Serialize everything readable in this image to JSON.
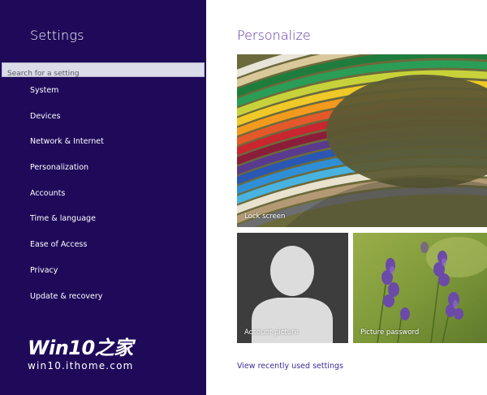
{
  "sidebar": {
    "title": "Settings",
    "search_placeholder": "Search for a setting",
    "items": [
      {
        "label": "System"
      },
      {
        "label": "Devices"
      },
      {
        "label": "Network & Internet"
      },
      {
        "label": "Personalization"
      },
      {
        "label": "Accounts"
      },
      {
        "label": "Time & language"
      },
      {
        "label": "Ease of Access"
      },
      {
        "label": "Privacy"
      },
      {
        "label": "Update & recovery"
      }
    ],
    "watermark_logo": "Win10之家",
    "watermark_url": "win10.ithome.com"
  },
  "main": {
    "title": "Personalize",
    "tiles": {
      "lock_screen": "Lock screen",
      "account_picture": "Account picture",
      "picture_password": "Picture password"
    },
    "recent_link": "View recently used settings"
  },
  "colors": {
    "sidebar_bg": "#1f0a5a",
    "accent": "#5a2d9e",
    "link": "#3d2a9a"
  }
}
